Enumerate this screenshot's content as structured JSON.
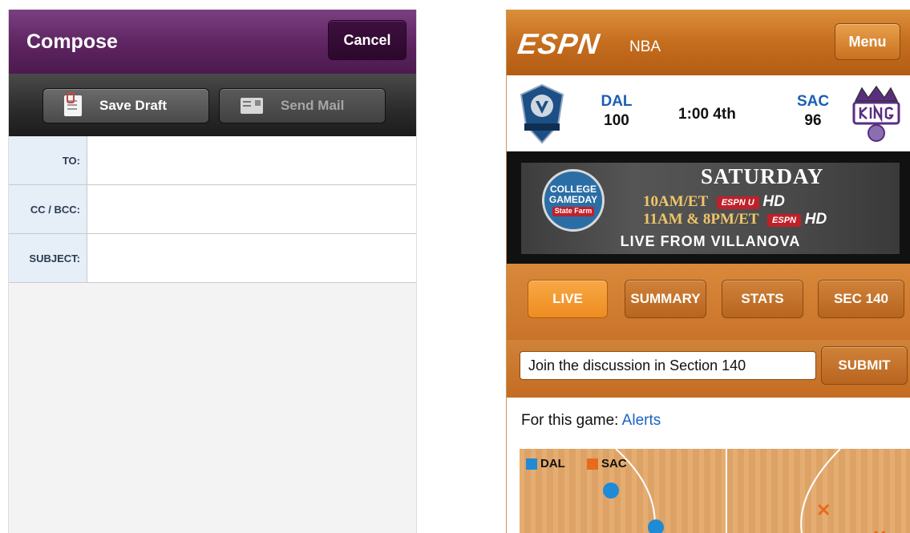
{
  "compose": {
    "title": "Compose",
    "cancel_label": "Cancel",
    "toolbar": {
      "save_draft_label": "Save Draft",
      "send_mail_label": "Send Mail"
    },
    "fields": {
      "to_label": "TO:",
      "cc_label": "CC / BCC:",
      "subject_label": "SUBJECT:"
    },
    "colors": {
      "header": "#5e2461",
      "toolbar": "#2a2a2a",
      "label_bg": "#e6eef8"
    }
  },
  "espn": {
    "logo": "ESPN",
    "section": "NBA",
    "menu_label": "Menu",
    "game": {
      "home_abbr": "DAL",
      "home_score": "100",
      "clock": "1:00 4th",
      "away_abbr": "SAC",
      "away_score": "96"
    },
    "promo": {
      "day": "SATURDAY",
      "badge_line1": "COLLEGE",
      "badge_line2": "GAMEDAY",
      "badge_sponsor": "State Farm",
      "time1": "10AM/ET",
      "network1": "ESPN U",
      "time2": "11AM & 8PM/ET",
      "network2": "ESPN",
      "hd": "HD",
      "live": "LIVE FROM VILLANOVA"
    },
    "tabs": [
      "LIVE",
      "SUMMARY",
      "STATS",
      "SEC 140"
    ],
    "active_tab": "LIVE",
    "discussion": {
      "input_value": "Join the discussion in Section 140",
      "submit_label": "SUBMIT"
    },
    "alerts": {
      "prefix": "For this game:",
      "link_label": "Alerts"
    },
    "shot_chart": {
      "legend": [
        {
          "label": "DAL",
          "color": "#1f8ad6"
        },
        {
          "label": "SAC",
          "color": "#e86a1c"
        }
      ]
    },
    "colors": {
      "brand_orange": "#c56d1f",
      "active_tab": "#ee8d20",
      "link": "#1a62c4"
    }
  }
}
